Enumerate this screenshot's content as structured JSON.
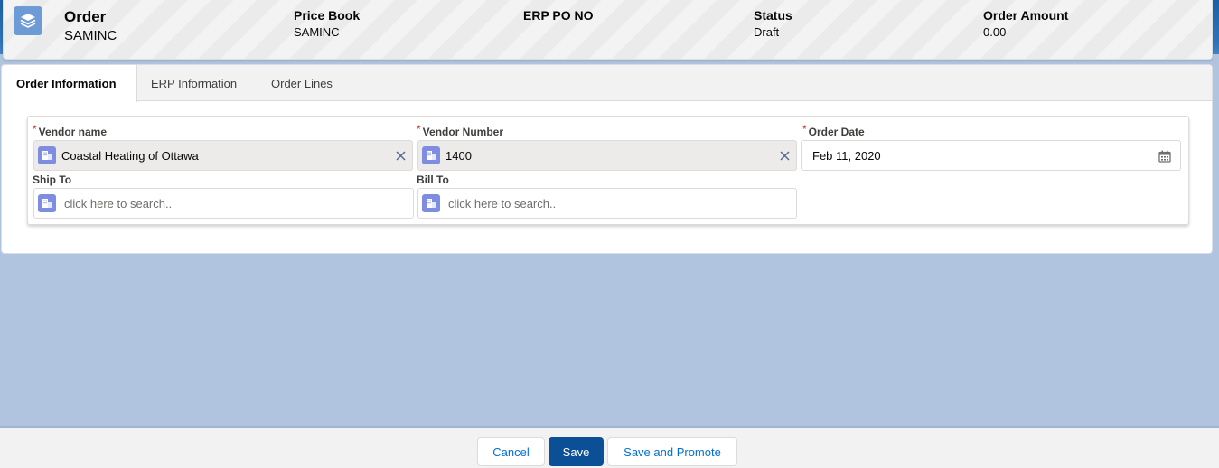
{
  "header": {
    "object_type": "Order",
    "record_name": "SAMINC",
    "icon": "stacked-layers-icon",
    "highlights": [
      {
        "label": "Price Book",
        "value": "SAMINC"
      },
      {
        "label": "ERP PO NO",
        "value": ""
      },
      {
        "label": "Status",
        "value": "Draft"
      },
      {
        "label": "Order Amount",
        "value": "0.00"
      }
    ]
  },
  "tabs": [
    {
      "label": "Order Information",
      "active": true
    },
    {
      "label": "ERP Information",
      "active": false
    },
    {
      "label": "Order Lines",
      "active": false
    }
  ],
  "form": {
    "vendor_name": {
      "label": "Vendor name",
      "required": true,
      "value": "Coastal Heating of Ottawa"
    },
    "vendor_number": {
      "label": "Vendor Number",
      "required": true,
      "value": "1400"
    },
    "order_date": {
      "label": "Order Date",
      "required": true,
      "value": "Feb 11, 2020"
    },
    "ship_to": {
      "label": "Ship To",
      "placeholder": "click here to search.."
    },
    "bill_to": {
      "label": "Bill To",
      "placeholder": "click here to search.."
    }
  },
  "footer": {
    "cancel_label": "Cancel",
    "save_label": "Save",
    "save_promote_label": "Save and Promote"
  },
  "colors": {
    "brand": "#0b4f97",
    "object_icon": "#6c9bd6",
    "lookup_icon": "#7f8de1",
    "required": "#c23934",
    "background": "#b0c4df"
  }
}
